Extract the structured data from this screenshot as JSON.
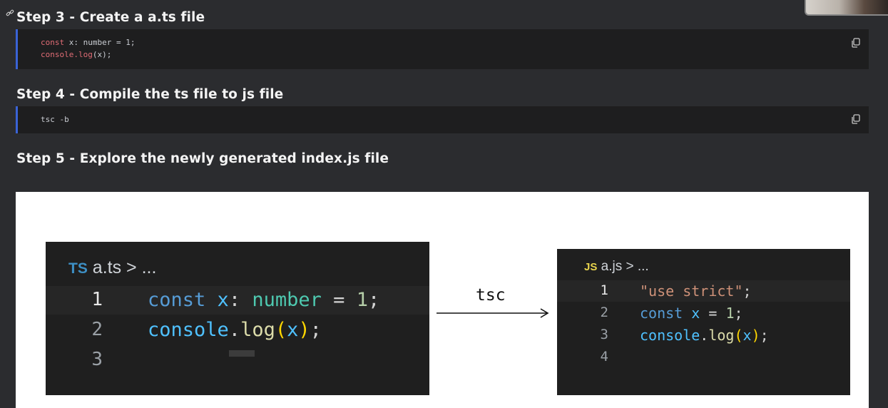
{
  "steps": [
    {
      "heading": "Step 3 - Create a a.ts file"
    },
    {
      "heading": "Step 4 - Compile the ts file to js file"
    },
    {
      "heading": "Step 5 - Explore the newly generated index.js file"
    }
  ],
  "step3_code": {
    "line1": {
      "kw": "const ",
      "rest": "x: number = 1;"
    },
    "line2": {
      "fn": "console.log",
      "rest": "(x);"
    }
  },
  "step4_code": {
    "line1": "tsc -b"
  },
  "diagram": {
    "left_editor": {
      "badge": "TS",
      "tab": " a.ts > ...",
      "line_numbers": [
        "1",
        "2",
        "3"
      ],
      "line1": {
        "kw": "const",
        "var": "x",
        "colon": ":",
        "type": "number",
        "eq": "=",
        "num": "1",
        "semi": ";"
      },
      "line2": {
        "obj": "console",
        "dot": ".",
        "fn": "log",
        "open": "(",
        "var": "x",
        "close": ")",
        "semi": ";"
      }
    },
    "arrow_label": "tsc",
    "right_editor": {
      "badge": "JS",
      "tab": " a.js > ...",
      "line_numbers": [
        "1",
        "2",
        "3",
        "4"
      ],
      "line1": {
        "str": "\"use strict\"",
        "semi": ";"
      },
      "line2": {
        "kw": "const",
        "var": "x",
        "eq": "=",
        "num": "1",
        "semi": ";"
      },
      "line3": {
        "obj": "console",
        "dot": ".",
        "fn": "log",
        "open": "(",
        "var": "x",
        "close": ")",
        "semi": ";"
      }
    }
  },
  "colors": {
    "accent_border": "#3a63d6",
    "code_bg": "#1e1e1f",
    "page_bg": "#2b2c2f"
  }
}
